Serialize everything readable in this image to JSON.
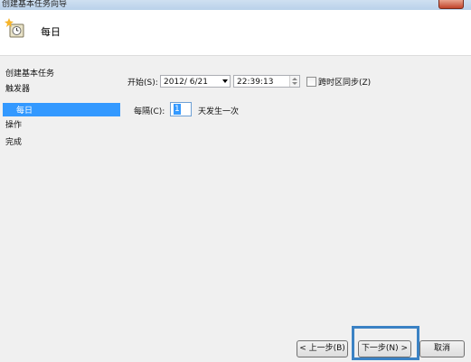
{
  "window": {
    "title": "创建基本任务向导"
  },
  "header": {
    "title": "每日"
  },
  "sidebar": {
    "items": [
      {
        "label": "创建基本任务"
      },
      {
        "label": "触发器"
      },
      {
        "label": "每日"
      },
      {
        "label": "操作"
      },
      {
        "label": "完成"
      }
    ]
  },
  "form": {
    "start_label": "开始(S):",
    "date_value": "2012/  6/21",
    "time_value": "22:39:13",
    "sync_label": "跨时区同步(Z)",
    "sync_checked": false,
    "every_label": "每隔(C):",
    "every_value": "1",
    "day_unit": "天发生一次"
  },
  "buttons": {
    "back": "< 上一步(B)",
    "next": "下一步(N) >",
    "cancel": "取消"
  },
  "colors": {
    "accent": "#3399ff",
    "focus": "#3b82c4"
  }
}
